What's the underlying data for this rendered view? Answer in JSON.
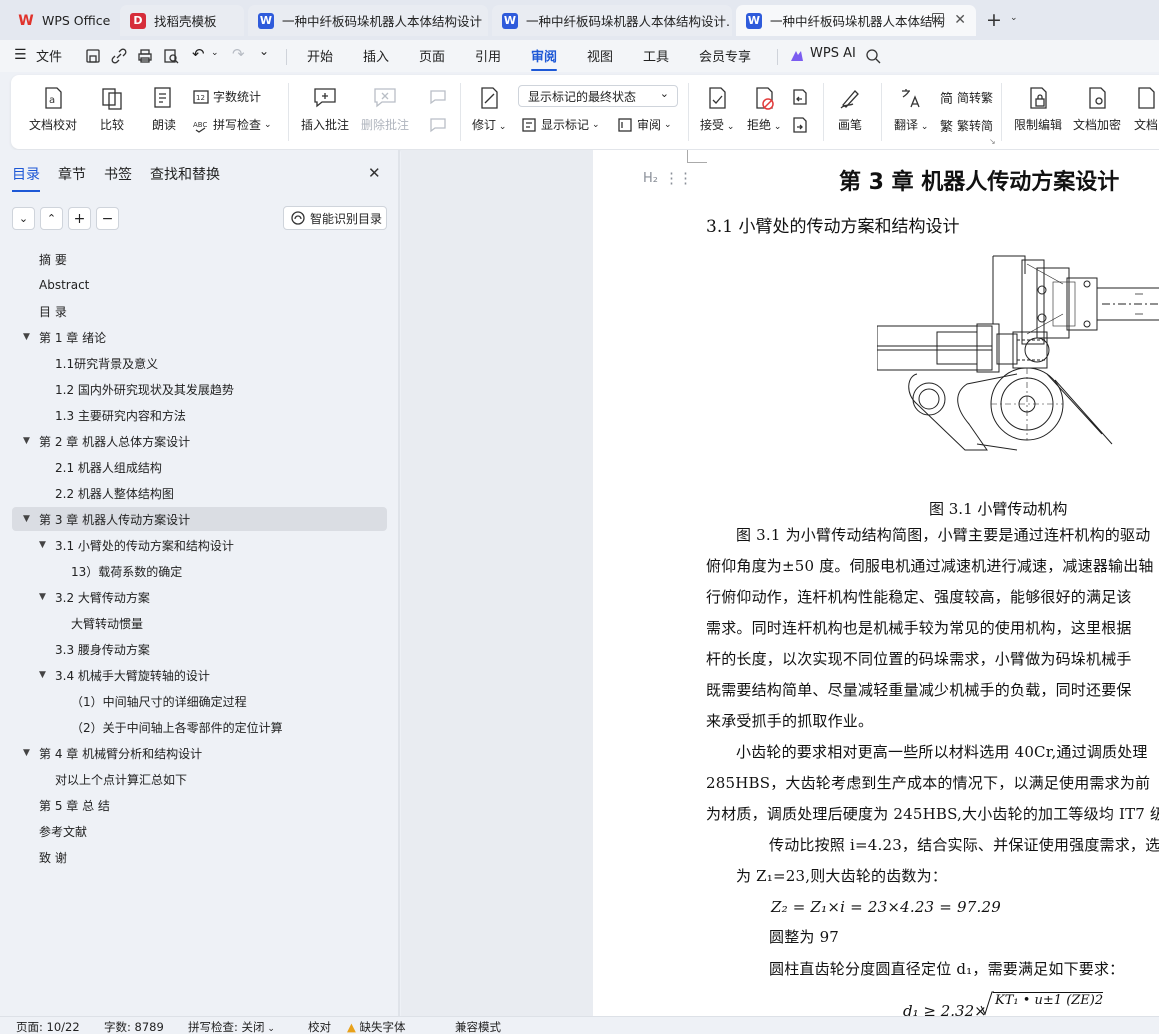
{
  "tabs": [
    {
      "label": "WPS Office",
      "logo": "W",
      "color": "#e0322b"
    },
    {
      "label": "找稻壳模板",
      "logo": "D",
      "color": "#d62d3a"
    },
    {
      "label": "一种中纤板码垛机器人本体结构设计",
      "logo": "W",
      "color": "#2f5bdb"
    },
    {
      "label": "一种中纤板码垛机器人本体结构设计.",
      "logo": "W",
      "color": "#2f5bdb"
    },
    {
      "label": "一种中纤板码垛机器人本体结构",
      "logo": "W",
      "color": "#2f5bdb"
    }
  ],
  "menubar": {
    "file": "文件",
    "items": [
      "开始",
      "插入",
      "页面",
      "引用",
      "审阅",
      "视图",
      "工具",
      "会员专享"
    ],
    "active": "审阅",
    "ai": "WPS AI"
  },
  "ribbon": {
    "doc_check": "文档校对",
    "compare": "比较",
    "read": "朗读",
    "word_count": "字数统计",
    "spell_check": "拼写检查",
    "insert_comment": "插入批注",
    "delete_comment": "删除批注",
    "track": "修订",
    "display_state": "显示标记的最终状态",
    "show_markup": "显示标记",
    "review": "审阅",
    "accept": "接受",
    "reject": "拒绝",
    "pen": "画笔",
    "translate": "翻译",
    "to_trad": "简转繁",
    "to_simp": "繁转简",
    "restrict": "限制编辑",
    "encrypt": "文档加密",
    "doc_more": "文档"
  },
  "panel": {
    "tabs": [
      "目录",
      "章节",
      "书签",
      "查找和替换"
    ],
    "smart_toc": "智能识别目录",
    "toc": [
      {
        "label": "摘 要",
        "level": 1,
        "tri": false
      },
      {
        "label": "Abstract",
        "level": 1,
        "tri": false
      },
      {
        "label": "目 录",
        "level": 1,
        "tri": false
      },
      {
        "label": "第 1 章   绪论",
        "level": 1,
        "tri": true
      },
      {
        "label": "1.1研究背景及意义",
        "level": 2,
        "tri": false
      },
      {
        "label": "1.2  国内外研究现状及其发展趋势",
        "level": 2,
        "tri": false
      },
      {
        "label": "1.3  主要研究内容和方法",
        "level": 2,
        "tri": false
      },
      {
        "label": "第 2 章   机器人总体方案设计",
        "level": 1,
        "tri": true
      },
      {
        "label": "2.1 机器人组成结构",
        "level": 2,
        "tri": false
      },
      {
        "label": "2.2 机器人整体结构图",
        "level": 2,
        "tri": false
      },
      {
        "label": "第 3 章  机器人传动方案设计",
        "level": 1,
        "tri": true,
        "selected": true
      },
      {
        "label": "3.1 小臂处的传动方案和结构设计",
        "level": 2,
        "tri": true
      },
      {
        "label": "13）载荷系数的确定",
        "level": 3,
        "tri": false
      },
      {
        "label": "3.2 大臂传动方案",
        "level": 2,
        "tri": true
      },
      {
        "label": "大臂转动惯量",
        "level": 3,
        "tri": false
      },
      {
        "label": "3.3 腰身传动方案",
        "level": 2,
        "tri": false
      },
      {
        "label": "3.4 机械手大臂旋转轴的设计",
        "level": 2,
        "tri": true
      },
      {
        "label": "（1）中间轴尺寸的详细确定过程",
        "level": 3,
        "tri": false
      },
      {
        "label": "（2）关于中间轴上各零部件的定位计算",
        "level": 3,
        "tri": false
      },
      {
        "label": "第 4 章  机械臂分析和结构设计",
        "level": 1,
        "tri": true
      },
      {
        "label": "对以上个点计算汇总如下",
        "level": 2,
        "tri": false
      },
      {
        "label": "第 5 章  总  结",
        "level": 1,
        "tri": false
      },
      {
        "label": "参考文献",
        "level": 1,
        "tri": false
      },
      {
        "label": "致  谢",
        "level": 1,
        "tri": false
      }
    ]
  },
  "document": {
    "heading_marker": "H₂",
    "chapter_title": "第 3 章  机器人传动方案设计",
    "section_title": "3.1 小臂处的传动方案和结构设计",
    "figure_caption": "图 3.1    小臂传动机构",
    "paragraphs": [
      "图 3.1 为小臂传动结构简图，小臂主要是通过连杆机构的驱动",
      "俯仰角度为±50 度。伺服电机通过减速机进行减速，减速器输出轴",
      "行俯仰动作，连杆机构性能稳定、强度较高，能够很好的满足该",
      "需求。同时连杆机构也是机械手较为常见的使用机构，这里根据",
      "杆的长度，以次实现不同位置的码垛需求，小臂做为码垛机械手",
      "既需要结构简单、尽量减轻重量减少机械手的负载，同时还要保",
      "来承受抓手的抓取作业。",
      "小齿轮的要求相对更高一些所以材料选用 40Cr,通过调质处理",
      "285HBS，大齿轮考虑到生产成本的情况下，以满足使用需求为前",
      "为材质，调质处理后硬度为 245HBS,大小齿轮的加工等级均 IT7 级",
      "传动比按照 i=4.23，结合实际、并保证使用强度需求，选",
      "为 Z₁=23,则大齿轮的齿数为：",
      "Z₂ = Z₁×i = 23×4.23 = 97.29",
      "圆整为 97",
      "圆柱直齿轮分度圆直径定位 d₁，需要满足如下要求："
    ],
    "formula_lhs": "d₁ ≥ 2.32×",
    "formula_body": "KT₁ • u±1 (ZE)2"
  },
  "status": {
    "page": "页面: 10/22",
    "words": "字数: 8789",
    "spell": "拼写检查: 关闭",
    "proof": "校对",
    "missing_font": "缺失字体",
    "compat": "兼容模式"
  }
}
